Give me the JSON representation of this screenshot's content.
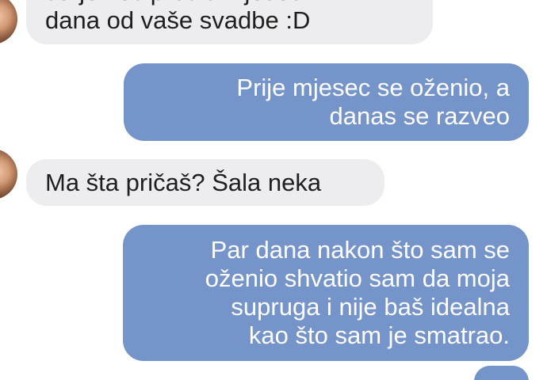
{
  "messages": [
    {
      "direction": "incoming",
      "text": "da je već prošlo mjesec\ndana od vaše svadbe :D"
    },
    {
      "direction": "outgoing",
      "text": "Prije mjesec se oženio, a\ndanas se razveo"
    },
    {
      "direction": "incoming",
      "text": "Ma šta pričaš? Šala neka"
    },
    {
      "direction": "outgoing",
      "text": "Par dana nakon što sam se\noženio shvatio sam da moja\nsupruga i nije baš idealna\nkao što sam je smatrao."
    },
    {
      "direction": "outgoing",
      "text": ""
    }
  ],
  "colors": {
    "incoming_bubble": "#ededf0",
    "outgoing_bubble": "#7594c9"
  }
}
